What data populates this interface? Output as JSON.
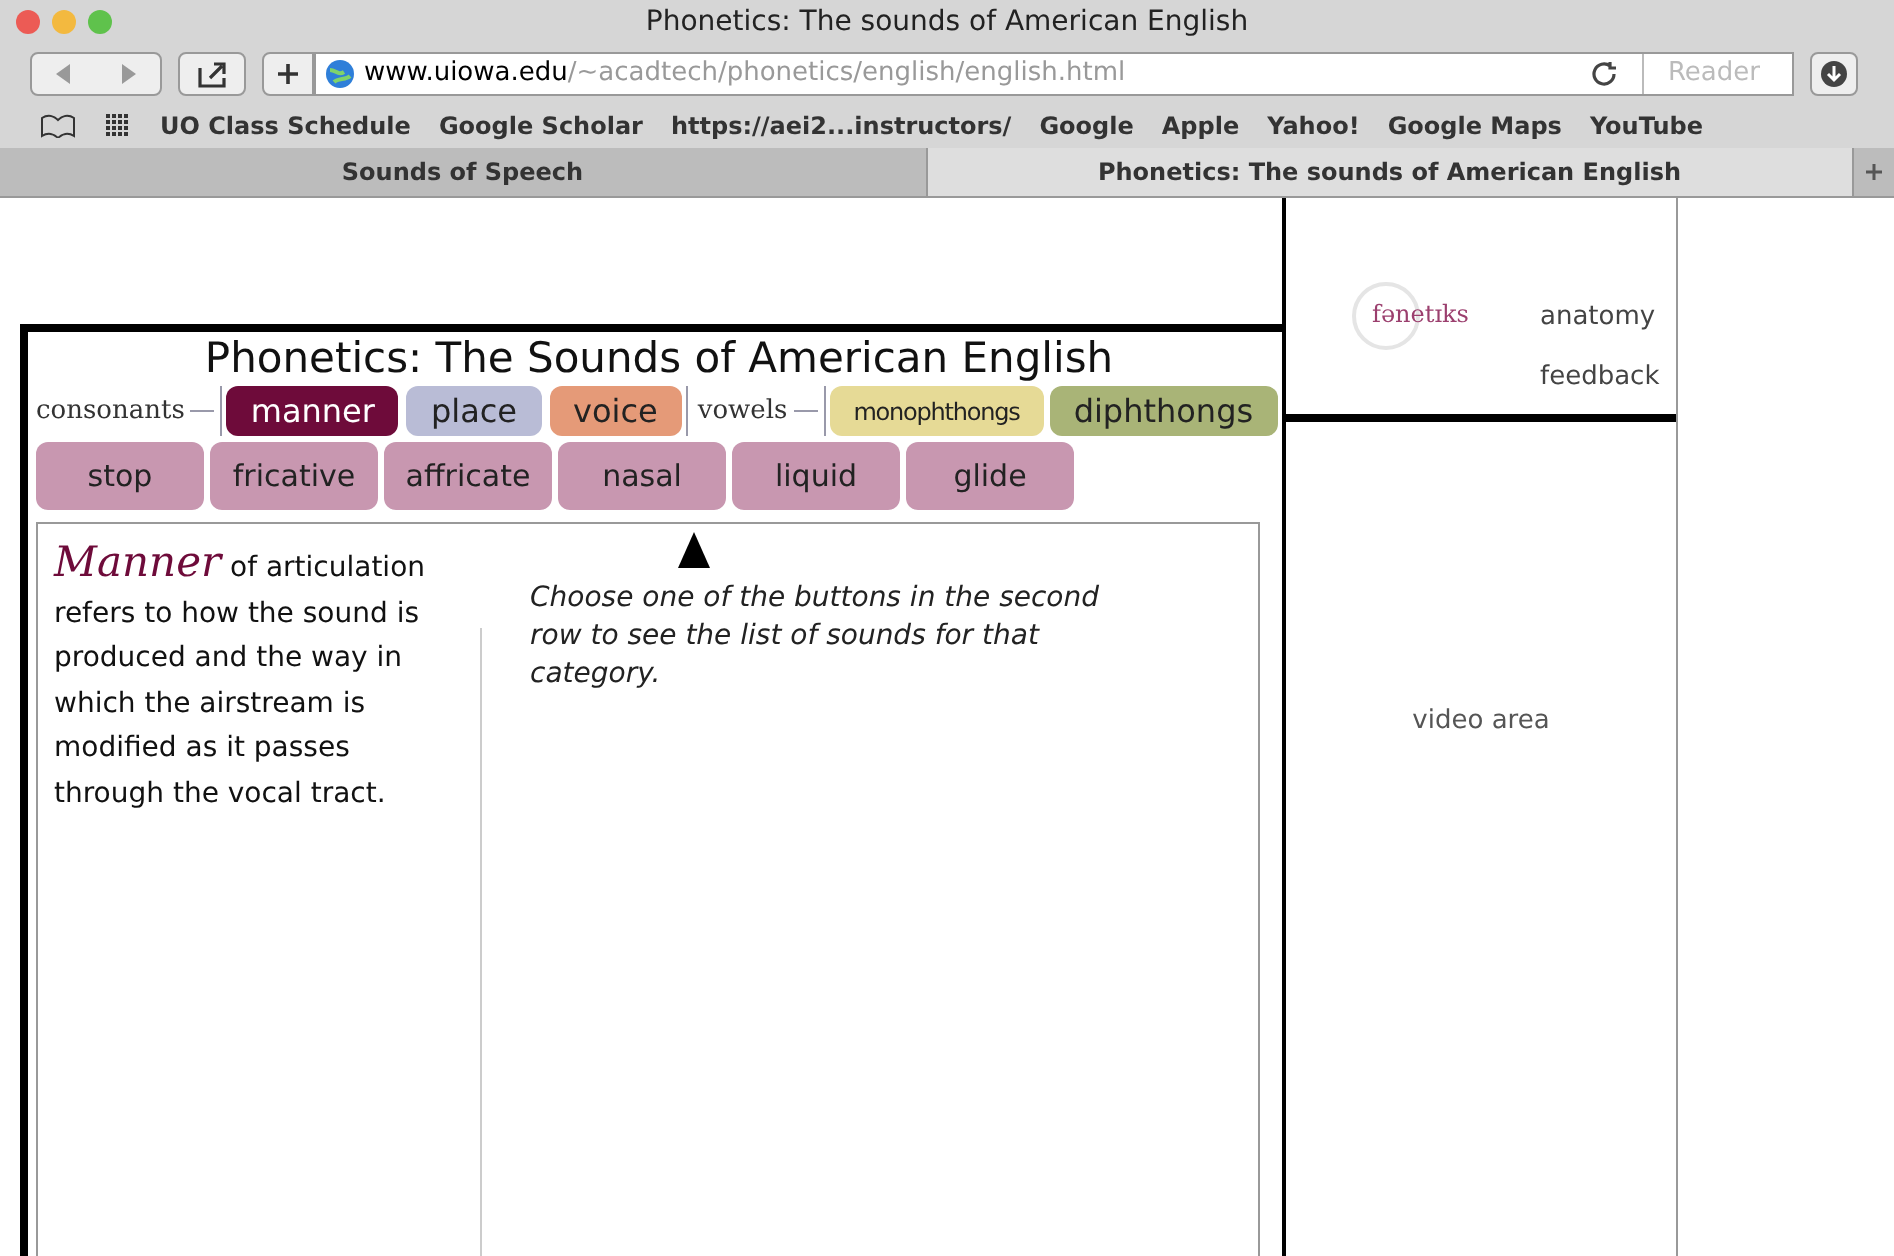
{
  "window": {
    "title": "Phonetics: The sounds of American English"
  },
  "toolbar": {
    "url_host": "www.uiowa.edu",
    "url_path": "/~acadtech/phonetics/english/english.html",
    "reader": {
      "label": "Reader",
      "disabled": true
    }
  },
  "bookmarks": [
    "UO Class Schedule",
    "Google Scholar",
    "https://aei2...instructors/",
    "Google",
    "Apple",
    "Yahoo!",
    "Google Maps",
    "YouTube"
  ],
  "tabs": [
    {
      "label": "Sounds of Speech",
      "selected": false
    },
    {
      "label": "Phonetics: The sounds of American English",
      "selected": true
    }
  ],
  "page": {
    "heading": "Phonetics:  The Sounds of American English",
    "consonants_label": "consonants",
    "consonant_tabs": [
      {
        "label": "manner",
        "selected": true,
        "color": "#6e0b3a"
      },
      {
        "label": "place",
        "selected": false,
        "color": "#b9bcd6"
      },
      {
        "label": "voice",
        "selected": false,
        "color": "#e59a78"
      }
    ],
    "vowels_label": "vowels",
    "vowel_tabs": [
      {
        "label": "monophthongs",
        "selected": false,
        "color": "#e6da96"
      },
      {
        "label": "diphthongs",
        "selected": false,
        "color": "#a9b477"
      }
    ],
    "categories": [
      "stop",
      "fricative",
      "affricate",
      "nasal",
      "liquid",
      "glide"
    ],
    "intro_term": "Manner",
    "intro_text": "of articulation refers to how the sound is produced and the way in which the airstream is modified as it passes through the vocal tract.",
    "instruction": "Choose one of the buttons in the second row to see the list of sounds for that category.",
    "logo": "fənetɪks",
    "links": [
      "anatomy",
      "feedback"
    ],
    "video_label": "video area"
  }
}
